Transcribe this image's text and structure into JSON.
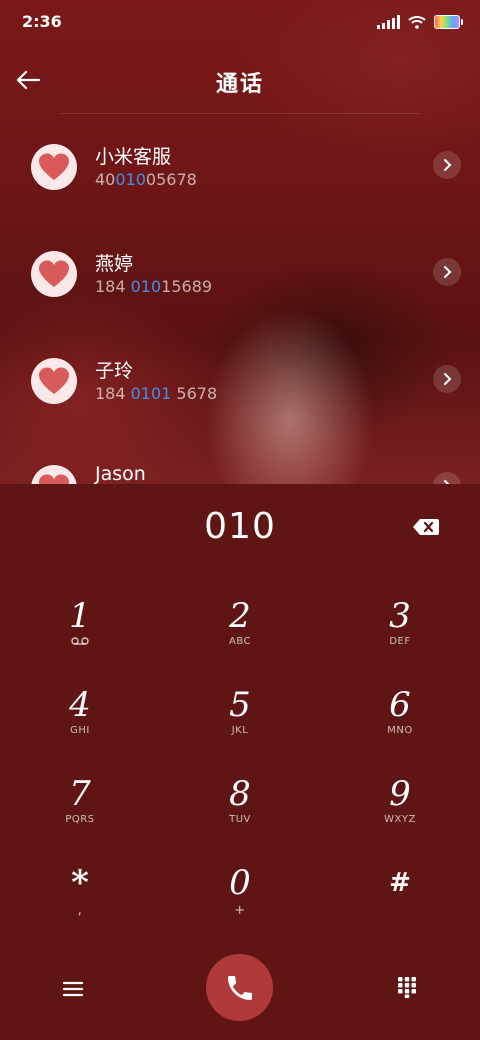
{
  "status": {
    "time": "2:36"
  },
  "header": {
    "title": "通话"
  },
  "contacts": [
    {
      "name": "小米客服",
      "num_pre": "40",
      "num_hl": "010",
      "num_post": "05678"
    },
    {
      "name": "燕婷",
      "num_pre": "184 ",
      "num_hl": "010",
      "num_post": "15689"
    },
    {
      "name": "子玲",
      "num_pre": "184 ",
      "num_hl": "0101",
      "num_post": " 5678"
    },
    {
      "name": "Jason",
      "num_pre": "",
      "num_hl": "",
      "num_post": ""
    }
  ],
  "dialer": {
    "typed": "010",
    "keys": [
      {
        "digit": "1",
        "letters": ""
      },
      {
        "digit": "2",
        "letters": "ABC"
      },
      {
        "digit": "3",
        "letters": "DEF"
      },
      {
        "digit": "4",
        "letters": "GHI"
      },
      {
        "digit": "5",
        "letters": "JKL"
      },
      {
        "digit": "6",
        "letters": "MNO"
      },
      {
        "digit": "7",
        "letters": "PQRS"
      },
      {
        "digit": "8",
        "letters": "TUV"
      },
      {
        "digit": "9",
        "letters": "WXYZ"
      },
      {
        "digit": "*",
        "letters": ","
      },
      {
        "digit": "0",
        "letters": "+"
      },
      {
        "digit": "#",
        "letters": ""
      }
    ]
  },
  "icons": {
    "back": "back-arrow-icon",
    "voicemail": "voicemail-icon",
    "menu": "menu-icon",
    "call": "phone-icon",
    "keypad": "keypad-icon",
    "backspace": "backspace-icon",
    "chevron": "chevron-right-icon",
    "avatar": "heart-avatar-icon"
  },
  "colors": {
    "accent": "#3f8fe8",
    "call_button": "#b03a3a",
    "dialer_bg": "#601515"
  }
}
